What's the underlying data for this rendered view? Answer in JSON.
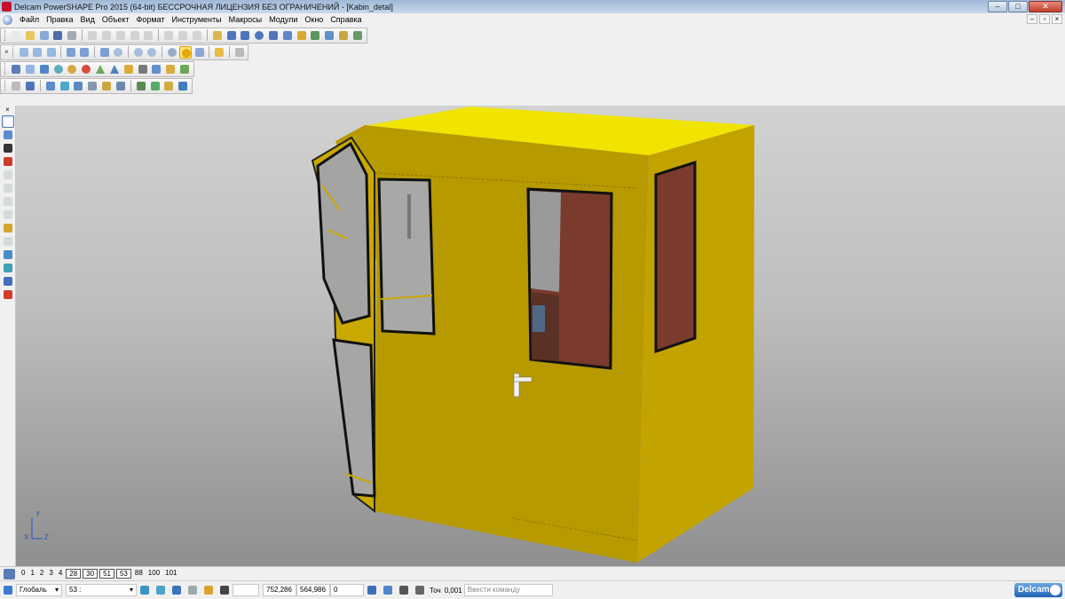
{
  "window": {
    "title": "Delcam PowerSHAPE Pro 2015 (64-bit) БЕССРОЧНАЯ ЛИЦЕНЗИЯ БЕЗ ОГРАНИЧЕНИЙ - [Kabin_detal]",
    "minimize_label": "–",
    "maximize_label": "□",
    "close_label": "✕"
  },
  "menu": {
    "items": [
      "Файл",
      "Правка",
      "Вид",
      "Объект",
      "Формат",
      "Инструменты",
      "Макросы",
      "Модули",
      "Окно",
      "Справка"
    ],
    "mdi_minimize": "–",
    "mdi_restore": "▫",
    "mdi_close": "×"
  },
  "toolbar_close": "×",
  "levels": {
    "items": [
      "0",
      "1",
      "2",
      "3",
      "4"
    ],
    "boxed": [
      "28",
      "30",
      "51",
      "53"
    ],
    "extra": [
      "88",
      "100",
      "101"
    ]
  },
  "status": {
    "workplane_select": "Глобаль",
    "level_select": "53 :",
    "x_coord": "752,286",
    "y_coord": "564,986",
    "z_coord": "0",
    "tolerance_label": "Точ",
    "tolerance_value": "0,001",
    "command_placeholder": "Ввести команду",
    "brand": "Delcam"
  },
  "axes": {
    "x": "X",
    "y": "Y",
    "z": "Z"
  },
  "colors": {
    "body_front": "#b89b00",
    "body_side": "#c3a300",
    "body_top": "#f3e500",
    "interior": "#7a3a2c"
  }
}
